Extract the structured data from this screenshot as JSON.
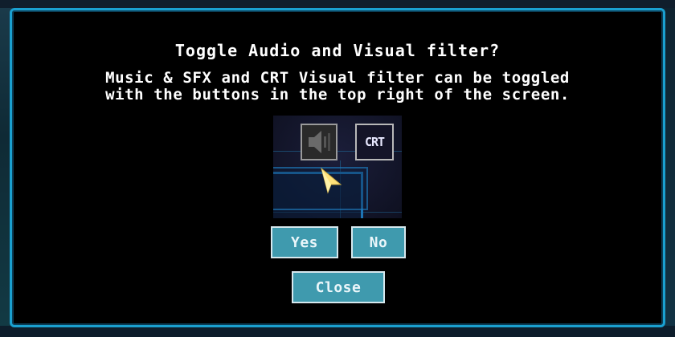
{
  "dialog": {
    "title": "Toggle Audio and Visual filter?",
    "message_line1": "Music & SFX and CRT Visual filter can be toggled",
    "message_line2": "with the buttons in the top right of the screen.",
    "border_color": "#1aa0d0",
    "background_color": "#000000"
  },
  "illustration": {
    "sound_button_icon": "speaker-icon",
    "crt_button_label": "CRT",
    "cursor_icon": "arrow-cursor-icon"
  },
  "buttons": {
    "yes_label": "Yes",
    "no_label": "No",
    "close_label": "Close",
    "button_color": "#3f9aae"
  }
}
